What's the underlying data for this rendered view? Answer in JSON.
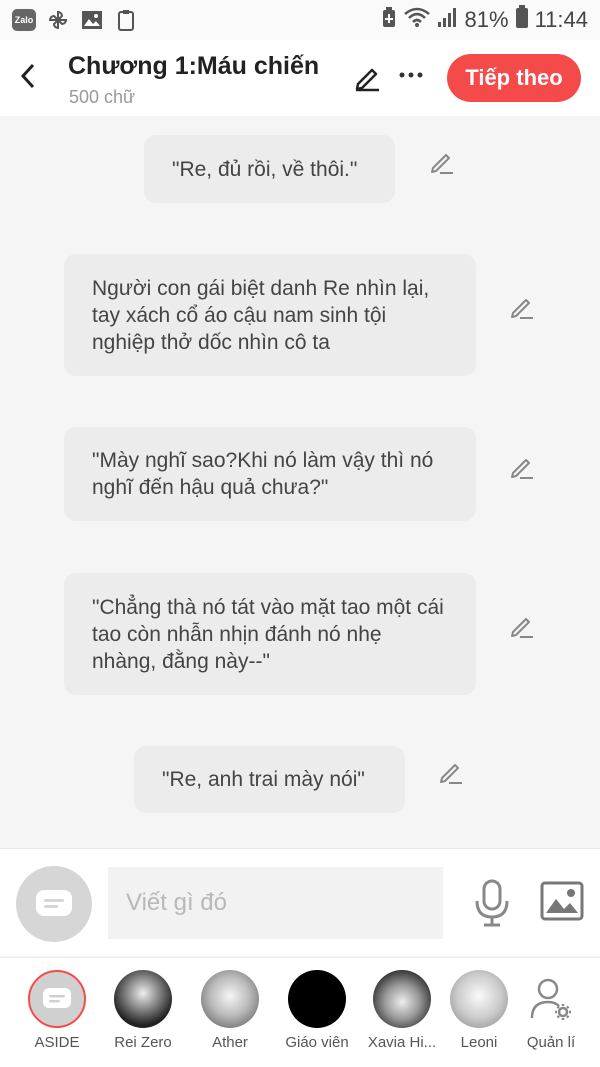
{
  "status_bar": {
    "battery": "81%",
    "time": "11:44",
    "left_icons": [
      "zalo-icon",
      "pinwheel-icon",
      "gallery-icon",
      "clipboard-icon"
    ],
    "right_icons": [
      "battery-saver-icon",
      "wifi-icon",
      "signal-icon",
      "battery-icon"
    ]
  },
  "header": {
    "title": "Chương 1:Máu chiến",
    "word_count": "500 chữ",
    "next_label": "Tiếp theo",
    "accent_color": "#f44a4a"
  },
  "messages": [
    {
      "text": "\"Re, đủ rồi, về thôi.\""
    },
    {
      "text": "Người con gái biệt danh Re nhìn lại, tay xách cổ áo cậu nam sinh tội nghiệp thở dốc nhìn cô ta"
    },
    {
      "text": "\"Mày nghĩ sao?Khi nó làm vậy thì nó nghĩ đến hậu quả chưa?\""
    },
    {
      "text": "\"Chẳng thà nó tát vào mặt tao một cái tao còn nhẫn nhịn đánh nó nhẹ nhàng, đằng này--\""
    },
    {
      "text": "\"Re, anh trai mày nói\""
    }
  ],
  "composer": {
    "placeholder": "Viết gì đó"
  },
  "characters": [
    {
      "label": "ASIDE"
    },
    {
      "label": "Rei Zero"
    },
    {
      "label": "Ather"
    },
    {
      "label": "Giáo viên"
    },
    {
      "label": "Xavia Hi..."
    },
    {
      "label": "Leoni"
    },
    {
      "label": "Quản lí"
    }
  ]
}
